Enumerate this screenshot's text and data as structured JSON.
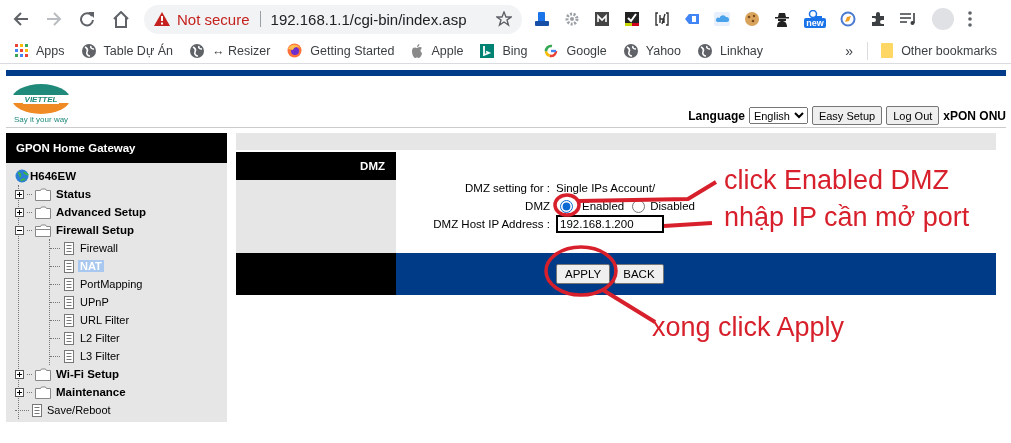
{
  "browser": {
    "security_label": "Not secure",
    "url": "192.168.1.1/cgi-bin/index.asp",
    "extension_badge": "new",
    "bookmarks": [
      {
        "label": "Apps",
        "kind": "apps"
      },
      {
        "label": "Table Dự Án",
        "kind": "globe"
      },
      {
        "label": "↔ Resizer",
        "kind": "globe"
      },
      {
        "label": "Getting Started",
        "kind": "flame"
      },
      {
        "label": "Apple",
        "kind": "apple"
      },
      {
        "label": "Bing",
        "kind": "tile"
      },
      {
        "label": "Google",
        "kind": "ring"
      },
      {
        "label": "Yahoo",
        "kind": "globe"
      },
      {
        "label": "Linkhay",
        "kind": "globe"
      }
    ],
    "overflow": "»",
    "other_bookmarks": "Other bookmarks"
  },
  "header": {
    "logo_text": "VIETTEL",
    "logo_tagline": "Say it your way",
    "language_label": "Language",
    "language": "English",
    "buttons": [
      "Easy Setup",
      "Log Out"
    ],
    "product": "xPON ONU"
  },
  "sidebar": {
    "title": "GPON Home Gateway",
    "root": "H646EW",
    "items": [
      {
        "label": "Status",
        "kind": "folder",
        "expanded": false,
        "selected": false
      },
      {
        "label": "Advanced Setup",
        "kind": "folder",
        "expanded": false,
        "selected": false
      },
      {
        "label": "Firewall Setup",
        "kind": "folder",
        "expanded": true,
        "selected": false,
        "children": [
          {
            "label": "Firewall",
            "kind": "page",
            "selected": false
          },
          {
            "label": "NAT",
            "kind": "page",
            "selected": true
          },
          {
            "label": "PortMapping",
            "kind": "page",
            "selected": false
          },
          {
            "label": "UPnP",
            "kind": "page",
            "selected": false
          },
          {
            "label": "URL Filter",
            "kind": "page",
            "selected": false
          },
          {
            "label": "L2 Filter",
            "kind": "page",
            "selected": false
          },
          {
            "label": "L3 Filter",
            "kind": "page",
            "selected": false
          }
        ]
      },
      {
        "label": "Wi-Fi Setup",
        "kind": "folder",
        "expanded": false,
        "selected": false
      },
      {
        "label": "Maintenance",
        "kind": "folder",
        "expanded": false,
        "selected": false
      },
      {
        "label": "Save/Reboot",
        "kind": "page",
        "selected": false
      }
    ]
  },
  "dmz": {
    "title": "DMZ",
    "setting_for_label": "DMZ setting for :",
    "setting_for_value": "Single IPs Account/",
    "dmz_label": "DMZ",
    "options": [
      {
        "label": "Enabled",
        "selected": true
      },
      {
        "label": "Disabled",
        "selected": false
      }
    ],
    "host_label": "DMZ Host IP Address :",
    "host_ip": "192.168.1.200",
    "buttons": [
      "APPLY",
      "BACK"
    ]
  },
  "annotations": [
    {
      "text": "click Enabled DMZ"
    },
    {
      "text": "nhập IP cần mở port"
    },
    {
      "text": "xong click Apply"
    }
  ]
}
